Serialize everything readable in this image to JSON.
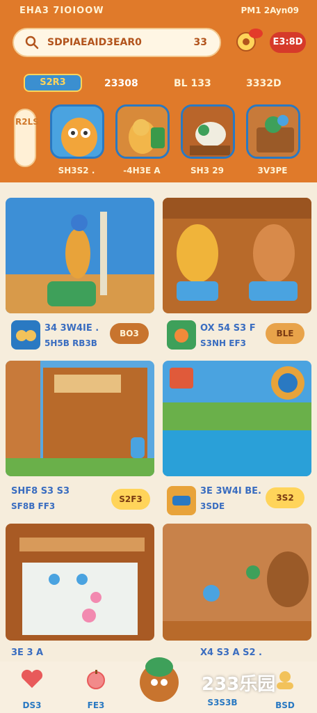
{
  "status": {
    "left": "EHA3 7IOIOOW",
    "right": "PM1 2Ayn09"
  },
  "search": {
    "text": "SDPIAEAID3EAR0",
    "count": "33"
  },
  "header": {
    "badge": "E3:8D"
  },
  "categories": {
    "logo": "S2R3",
    "tabs": [
      "23308",
      "BL 133",
      "3332D"
    ]
  },
  "side_pill": "R2LS",
  "games": [
    {
      "label": "SH3S2 ."
    },
    {
      "label": "-4H3E A"
    },
    {
      "label": "SH3 29"
    },
    {
      "label": "3V3PE"
    }
  ],
  "cards": [
    {
      "title": "34 3W4IE .",
      "sub": "5H5B RB3B",
      "btn": "BO3"
    },
    {
      "title": "OX 54 S3 F",
      "sub": "S3NH EF3",
      "btn": "BLE"
    },
    {
      "title": "SHF8 S3 S3",
      "sub": "SF8B FF3",
      "btn": "S2F3"
    },
    {
      "title": "3E 3W4I BE.",
      "sub": "3SDE",
      "btn": "3S2"
    },
    {
      "title": "3E 3 A",
      "sub": "",
      "btn": ""
    },
    {
      "title": "X4 S3 A S2 .",
      "sub": "",
      "btn": ""
    }
  ],
  "nav": [
    "DS3",
    "FE3",
    "S3S3B",
    "BSD"
  ],
  "watermark": "233乐园",
  "colors": {
    "header": "#e07a2a",
    "accent_blue": "#2a79c2",
    "background": "#f6eddc"
  }
}
